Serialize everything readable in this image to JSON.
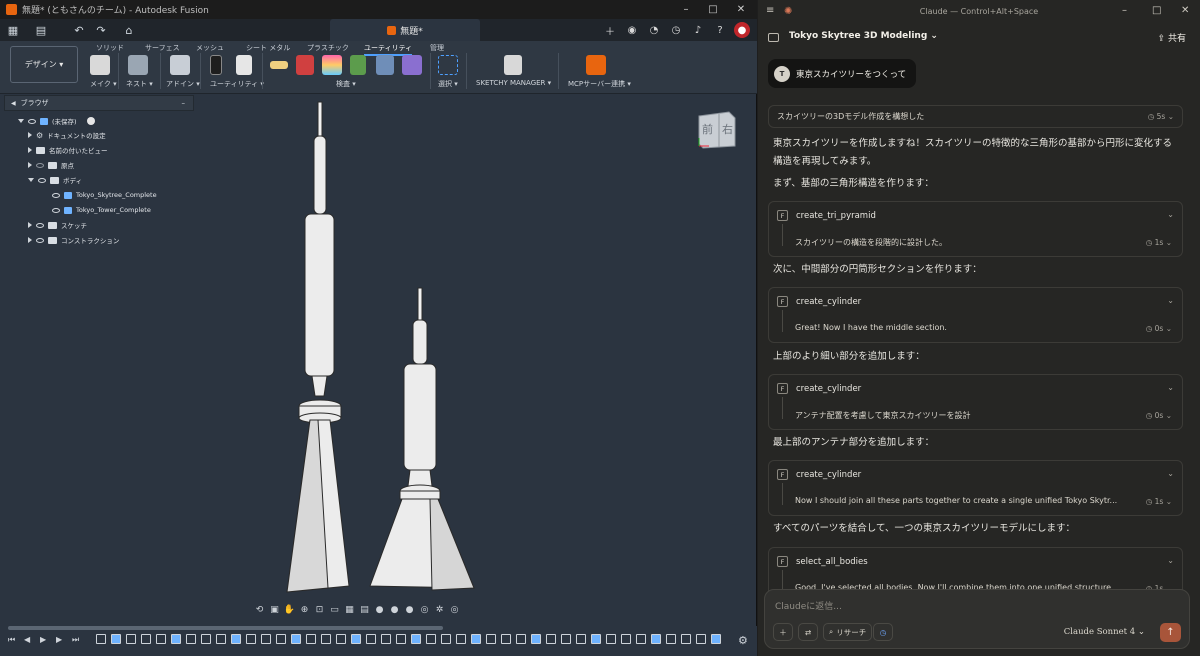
{
  "fusion": {
    "title": "無題* (ともさんのチーム) - Autodesk Fusion",
    "doc_tab": "無題*",
    "design_label": "デザイン",
    "workspace_tabs": [
      "ソリッド",
      "サーフェス",
      "メッシュ",
      "シート メタル",
      "プラスチック",
      "ユーティリティ",
      "管理"
    ],
    "tool_groups": [
      "メイク",
      "ネスト",
      "アドイン",
      "ユーティリティ",
      "検査",
      "選択",
      "SKETCHY MANAGER",
      "MCPサーバー連携"
    ],
    "browser": {
      "title": "ブラウザ",
      "items": [
        {
          "label": "(未保存)"
        },
        {
          "label": "ドキュメントの設定"
        },
        {
          "label": "名前の付いたビュー"
        },
        {
          "label": "原点"
        },
        {
          "label": "ボディ"
        },
        {
          "label": "Tokyo_Skytree_Complete"
        },
        {
          "label": "Tokyo_Tower_Complete"
        },
        {
          "label": "スケッチ"
        },
        {
          "label": "コンストラクション"
        }
      ]
    },
    "viewcube": {
      "front": "前",
      "right": "右"
    },
    "accent": "#4ea0ff"
  },
  "claude": {
    "window_title": "Claude — Control+Alt+Space",
    "project": "Tokyo Skytree 3D Modeling",
    "share": "共有",
    "user_initial": "T",
    "user_message": "東京スカイツリーをつくって",
    "thought": {
      "label": "スカイツリーの3Dモデル作成を構想した",
      "time": "5s"
    },
    "messages": [
      "東京スカイツリーを作成しますね！スカイツリーの特徴的な三角形の基部から円形に変化する構造を再現してみます。",
      "まず、基部の三角形構造を作ります：",
      "次に、中間部分の円筒形セクションを作ります：",
      "上部のより細い部分を追加します：",
      "最上部のアンテナ部分を追加します：",
      "すべてのパーツを結合して、一つの東京スカイツリーモデルにします："
    ],
    "tools": [
      {
        "name": "create_tri_pyramid",
        "result": "スカイツリーの構造を段階的に設計した。",
        "time": "1s"
      },
      {
        "name": "create_cylinder",
        "result": "Great! Now I have the middle section.",
        "time": "0s"
      },
      {
        "name": "create_cylinder",
        "result": "アンテナ配置を考慮して東京スカイツリーを設計",
        "time": "0s"
      },
      {
        "name": "create_cylinder",
        "result": "Now I should join all these parts together to create a single unified Tokyo Skytr...",
        "time": "1s"
      },
      {
        "name": "select_all_bodies",
        "result": "Good, I've selected all bodies. Now I'll combine them into one unified structure.",
        "time": "1s"
      }
    ],
    "composer": {
      "placeholder": "Claudeに返信...",
      "research": "リサーチ",
      "model": "Claude Sonnet 4"
    },
    "accent": "#d97757"
  }
}
